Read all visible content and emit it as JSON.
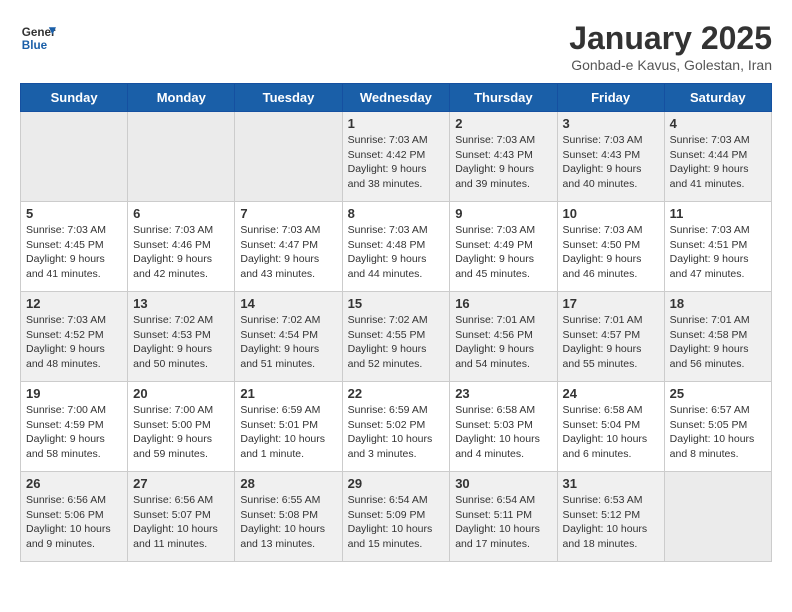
{
  "header": {
    "logo_line1": "General",
    "logo_line2": "Blue",
    "month_year": "January 2025",
    "location": "Gonbad-e Kavus, Golestan, Iran"
  },
  "weekdays": [
    "Sunday",
    "Monday",
    "Tuesday",
    "Wednesday",
    "Thursday",
    "Friday",
    "Saturday"
  ],
  "weeks": [
    [
      {
        "day": "",
        "info": ""
      },
      {
        "day": "",
        "info": ""
      },
      {
        "day": "",
        "info": ""
      },
      {
        "day": "1",
        "info": "Sunrise: 7:03 AM\nSunset: 4:42 PM\nDaylight: 9 hours\nand 38 minutes."
      },
      {
        "day": "2",
        "info": "Sunrise: 7:03 AM\nSunset: 4:43 PM\nDaylight: 9 hours\nand 39 minutes."
      },
      {
        "day": "3",
        "info": "Sunrise: 7:03 AM\nSunset: 4:43 PM\nDaylight: 9 hours\nand 40 minutes."
      },
      {
        "day": "4",
        "info": "Sunrise: 7:03 AM\nSunset: 4:44 PM\nDaylight: 9 hours\nand 41 minutes."
      }
    ],
    [
      {
        "day": "5",
        "info": "Sunrise: 7:03 AM\nSunset: 4:45 PM\nDaylight: 9 hours\nand 41 minutes."
      },
      {
        "day": "6",
        "info": "Sunrise: 7:03 AM\nSunset: 4:46 PM\nDaylight: 9 hours\nand 42 minutes."
      },
      {
        "day": "7",
        "info": "Sunrise: 7:03 AM\nSunset: 4:47 PM\nDaylight: 9 hours\nand 43 minutes."
      },
      {
        "day": "8",
        "info": "Sunrise: 7:03 AM\nSunset: 4:48 PM\nDaylight: 9 hours\nand 44 minutes."
      },
      {
        "day": "9",
        "info": "Sunrise: 7:03 AM\nSunset: 4:49 PM\nDaylight: 9 hours\nand 45 minutes."
      },
      {
        "day": "10",
        "info": "Sunrise: 7:03 AM\nSunset: 4:50 PM\nDaylight: 9 hours\nand 46 minutes."
      },
      {
        "day": "11",
        "info": "Sunrise: 7:03 AM\nSunset: 4:51 PM\nDaylight: 9 hours\nand 47 minutes."
      }
    ],
    [
      {
        "day": "12",
        "info": "Sunrise: 7:03 AM\nSunset: 4:52 PM\nDaylight: 9 hours\nand 48 minutes."
      },
      {
        "day": "13",
        "info": "Sunrise: 7:02 AM\nSunset: 4:53 PM\nDaylight: 9 hours\nand 50 minutes."
      },
      {
        "day": "14",
        "info": "Sunrise: 7:02 AM\nSunset: 4:54 PM\nDaylight: 9 hours\nand 51 minutes."
      },
      {
        "day": "15",
        "info": "Sunrise: 7:02 AM\nSunset: 4:55 PM\nDaylight: 9 hours\nand 52 minutes."
      },
      {
        "day": "16",
        "info": "Sunrise: 7:01 AM\nSunset: 4:56 PM\nDaylight: 9 hours\nand 54 minutes."
      },
      {
        "day": "17",
        "info": "Sunrise: 7:01 AM\nSunset: 4:57 PM\nDaylight: 9 hours\nand 55 minutes."
      },
      {
        "day": "18",
        "info": "Sunrise: 7:01 AM\nSunset: 4:58 PM\nDaylight: 9 hours\nand 56 minutes."
      }
    ],
    [
      {
        "day": "19",
        "info": "Sunrise: 7:00 AM\nSunset: 4:59 PM\nDaylight: 9 hours\nand 58 minutes."
      },
      {
        "day": "20",
        "info": "Sunrise: 7:00 AM\nSunset: 5:00 PM\nDaylight: 9 hours\nand 59 minutes."
      },
      {
        "day": "21",
        "info": "Sunrise: 6:59 AM\nSunset: 5:01 PM\nDaylight: 10 hours\nand 1 minute."
      },
      {
        "day": "22",
        "info": "Sunrise: 6:59 AM\nSunset: 5:02 PM\nDaylight: 10 hours\nand 3 minutes."
      },
      {
        "day": "23",
        "info": "Sunrise: 6:58 AM\nSunset: 5:03 PM\nDaylight: 10 hours\nand 4 minutes."
      },
      {
        "day": "24",
        "info": "Sunrise: 6:58 AM\nSunset: 5:04 PM\nDaylight: 10 hours\nand 6 minutes."
      },
      {
        "day": "25",
        "info": "Sunrise: 6:57 AM\nSunset: 5:05 PM\nDaylight: 10 hours\nand 8 minutes."
      }
    ],
    [
      {
        "day": "26",
        "info": "Sunrise: 6:56 AM\nSunset: 5:06 PM\nDaylight: 10 hours\nand 9 minutes."
      },
      {
        "day": "27",
        "info": "Sunrise: 6:56 AM\nSunset: 5:07 PM\nDaylight: 10 hours\nand 11 minutes."
      },
      {
        "day": "28",
        "info": "Sunrise: 6:55 AM\nSunset: 5:08 PM\nDaylight: 10 hours\nand 13 minutes."
      },
      {
        "day": "29",
        "info": "Sunrise: 6:54 AM\nSunset: 5:09 PM\nDaylight: 10 hours\nand 15 minutes."
      },
      {
        "day": "30",
        "info": "Sunrise: 6:54 AM\nSunset: 5:11 PM\nDaylight: 10 hours\nand 17 minutes."
      },
      {
        "day": "31",
        "info": "Sunrise: 6:53 AM\nSunset: 5:12 PM\nDaylight: 10 hours\nand 18 minutes."
      },
      {
        "day": "",
        "info": ""
      }
    ]
  ]
}
